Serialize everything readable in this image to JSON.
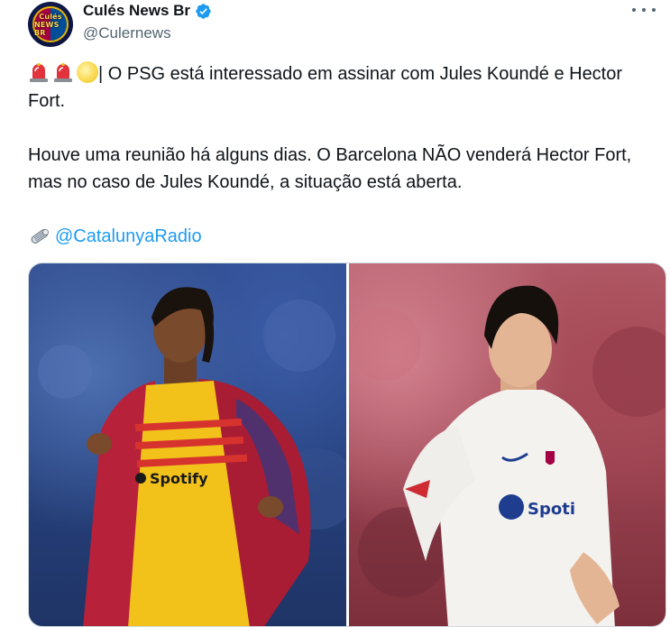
{
  "author": {
    "display_name": "Culés News Br",
    "handle": "@Culernews",
    "avatar_text_line1": "Culés",
    "avatar_text_line2": "NEWS BR"
  },
  "tweet": {
    "paragraph1": "| O PSG está interessado em assinar com Jules Koundé e Hector Fort.",
    "paragraph2": "Houve uma reunião há alguns dias. O Barcelona NÃO venderá Hector Fort, mas no caso de Jules Koundé, a situação está aberta.",
    "mention": "@CatalunyaRadio"
  },
  "media": {
    "left_sponsor": "Spotify",
    "right_sponsor": "Spoti"
  },
  "icons": {
    "verified": "verified-badge-icon",
    "more": "more-options-icon",
    "siren": "police-siren-icon",
    "sun": "sun-icon",
    "newspaper": "rolled-newspaper-icon"
  },
  "colors": {
    "accent": "#1d9bf0",
    "secondary_text": "#536471",
    "barca_blaugrana_red": "#a50044",
    "barca_blaugrana_blue": "#004d98"
  }
}
